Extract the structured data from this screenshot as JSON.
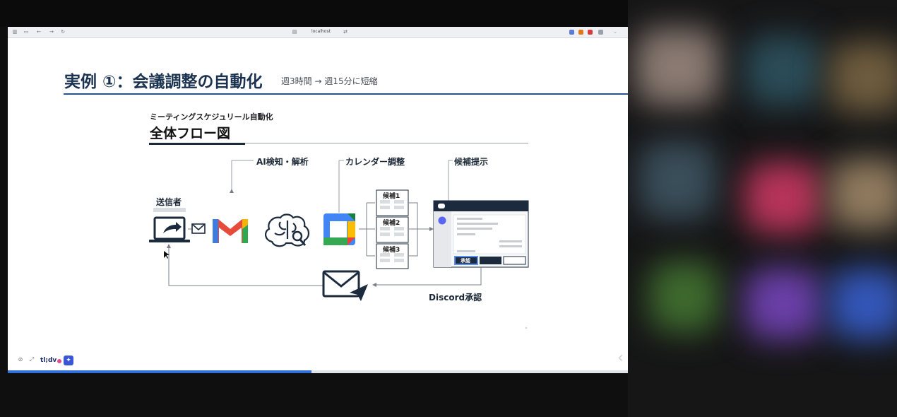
{
  "browser": {
    "url": "localhost"
  },
  "slide": {
    "title": "実例 ①：会議調整の自動化",
    "subtitle": "週3時間 → 週15分に短縮"
  },
  "diagram": {
    "caption": "ミーティングスケジュリール自動化",
    "title": "全体フロー図",
    "labels": {
      "ai": "AI検知・解析",
      "calendar": "カレンダー調整",
      "proposal": "候補提示",
      "sender": "送信者",
      "discord": "Discord承認"
    },
    "candidates": [
      "候補1",
      "候補2",
      "候補3"
    ],
    "approve_button": "承認"
  },
  "footer": {
    "tldv": "tl;dv",
    "progress": 0.49
  },
  "colors": {
    "title": "#1b3350",
    "rule": "#27558a",
    "discord_header": "#1b2a3d",
    "accent_blue": "#2f6fd6"
  }
}
